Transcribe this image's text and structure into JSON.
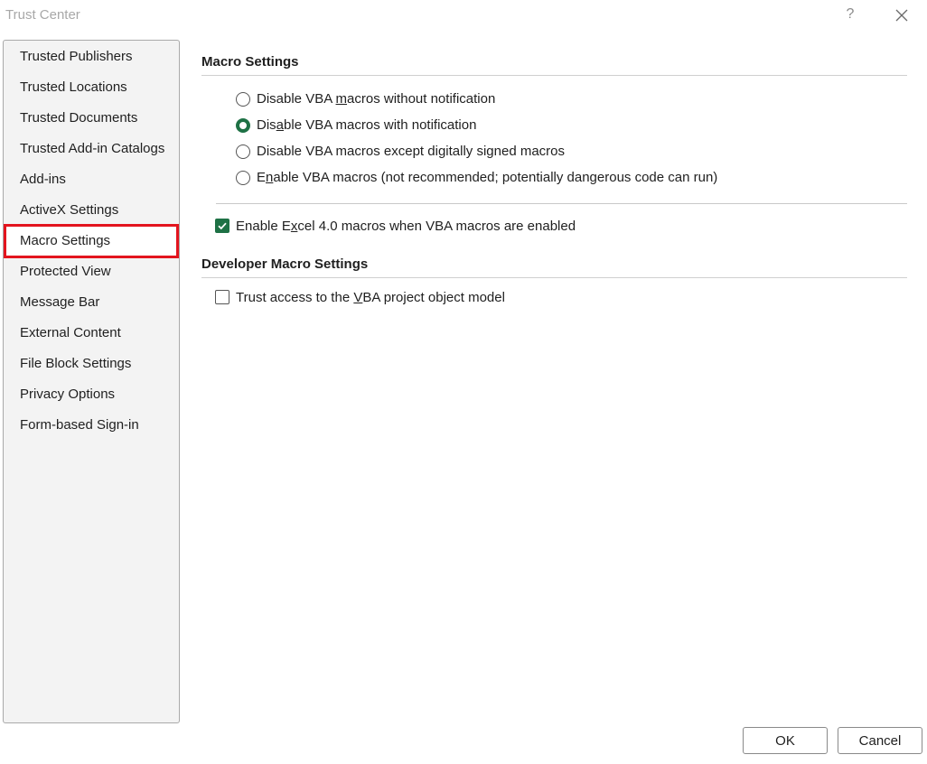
{
  "window": {
    "title": "Trust Center",
    "help_label": "?"
  },
  "sidebar": {
    "selected_index": 6,
    "items": [
      {
        "label": "Trusted Publishers"
      },
      {
        "label": "Trusted Locations"
      },
      {
        "label": "Trusted Documents"
      },
      {
        "label": "Trusted Add-in Catalogs"
      },
      {
        "label": "Add-ins"
      },
      {
        "label": "ActiveX Settings"
      },
      {
        "label": "Macro Settings"
      },
      {
        "label": "Protected View"
      },
      {
        "label": "Message Bar"
      },
      {
        "label": "External Content"
      },
      {
        "label": "File Block Settings"
      },
      {
        "label": "Privacy Options"
      },
      {
        "label": "Form-based Sign-in"
      }
    ]
  },
  "macro_settings": {
    "title": "Macro Settings",
    "options": [
      {
        "pre": "Disable VBA ",
        "ul": "m",
        "post": "acros without notification",
        "checked": false
      },
      {
        "pre": "Dis",
        "ul": "a",
        "post": "ble VBA macros with notification",
        "checked": true
      },
      {
        "pre": "Disable VBA macros except di",
        "ul": "g",
        "post": "itally signed macros",
        "checked": false
      },
      {
        "pre": "E",
        "ul": "n",
        "post": "able VBA macros (not recommended; potentially dangerous code can run)",
        "checked": false
      }
    ],
    "excel4": {
      "pre": "Enable E",
      "ul": "x",
      "post": "cel 4.0 macros when VBA macros are enabled",
      "checked": true
    }
  },
  "developer_macro_settings": {
    "title": "Developer Macro Settings",
    "trust_vba": {
      "pre": "Trust access to the ",
      "ul": "V",
      "post": "BA project object model",
      "checked": false
    }
  },
  "footer": {
    "ok_label": "OK",
    "cancel_label": "Cancel"
  },
  "colors": {
    "accent": "#1e7145",
    "highlight": "#e3141e"
  }
}
